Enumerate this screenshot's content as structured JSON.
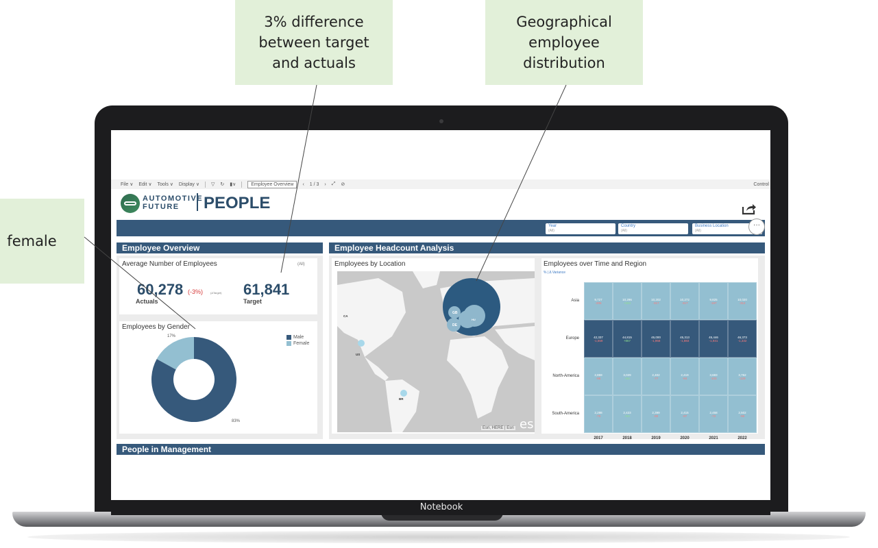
{
  "callouts": {
    "difference": "3% difference between target and actuals",
    "geo": "Geographical employee distribution",
    "gender": "female"
  },
  "laptop": {
    "brand": "Notebook"
  },
  "toolbar": {
    "file": "File ∨",
    "edit": "Edit ∨",
    "tools": "Tools ∨",
    "display": "Display ∨",
    "page_select": "Employee Overview",
    "page_counter": "1 / 3",
    "controls": "Control"
  },
  "header": {
    "logo_line1": "AUTOMOTIVE",
    "logo_line2": "FUTURE",
    "title": "PEOPLE"
  },
  "filters": [
    {
      "label": "Year",
      "value": "(All)"
    },
    {
      "label": "Country",
      "value": "(All)"
    },
    {
      "label": "Business Location",
      "value": "(All)"
    }
  ],
  "sections": {
    "overview": "Employee Overview",
    "headcount": "Employee Headcount Analysis",
    "management": "People in Management"
  },
  "kpi": {
    "title": "Average Number of Employees",
    "filter_tag": "(All)",
    "actual": "60,278",
    "variance": "(-3%)",
    "variance_note": "(ΔTarget)",
    "actual_label": "Actuals",
    "target": "61,841",
    "target_label": "Target"
  },
  "gender": {
    "title": "Employees by Gender",
    "male_label": "Male",
    "female_label": "Female",
    "female_pct_label": "17%",
    "male_pct_label": "83%",
    "male_share": 0.83,
    "female_share": 0.17,
    "male_color": "#36597b",
    "female_color": "#93bfd1"
  },
  "map": {
    "title": "Employees by Location",
    "credit": "Esri, HERE | Esri",
    "logo": "esri",
    "labels": {
      "gb": "GB",
      "de": "DE",
      "hu": "HU",
      "ca": "CA",
      "us": "US",
      "br": "BR"
    }
  },
  "heatmap": {
    "title": "Employees over Time and Region",
    "subtitle": "% | Δ Variance",
    "years": [
      "2017",
      "2018",
      "2019",
      "2020",
      "2021",
      "2022"
    ],
    "rows": [
      {
        "region": "Asia",
        "values": [
          "9,727",
          "10,296",
          "10,202",
          "10,272",
          "9,825",
          "10,020"
        ],
        "deltas": [
          "-205",
          "+204",
          "-317",
          "-317",
          "-197",
          "-312"
        ]
      },
      {
        "region": "Europe",
        "values": [
          "42,337",
          "44,815",
          "45,000",
          "45,313",
          "45,446",
          "46,373"
        ],
        "deltas": [
          "-1,559",
          "+867",
          "-1,958",
          "-1,883",
          "-1,931",
          "-1,332"
        ]
      },
      {
        "region": "North-America",
        "values": [
          "2,859",
          "3,029",
          "2,402",
          "2,419",
          "3,683",
          "3,762"
        ],
        "deltas": [
          "-86",
          "+84",
          "-77",
          "-84",
          "-103",
          "-129"
        ]
      },
      {
        "region": "South-America",
        "values": [
          "2,288",
          "2,423",
          "2,399",
          "2,415",
          "2,458",
          "2,502"
        ],
        "deltas": [
          "-70",
          "+93",
          "-80",
          "-87",
          "-72",
          "-90"
        ]
      }
    ],
    "colors": {
      "dark": "#36597b",
      "light": "#93bfd1"
    }
  }
}
